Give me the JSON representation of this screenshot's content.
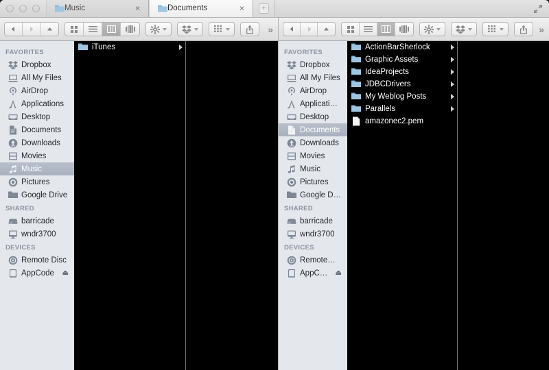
{
  "window": {
    "traffic_lights": [
      "close",
      "minimize",
      "zoom"
    ],
    "fullscreen_label": "Enter Full Screen"
  },
  "tabs": [
    {
      "label": "Music",
      "icon": "folder-icon",
      "active": false,
      "close_label": "×"
    },
    {
      "label": "Documents",
      "icon": "folder-icon",
      "active": true,
      "close_label": "×"
    }
  ],
  "new_tab_button": "+",
  "toolbar": {
    "nav": {
      "back": "◀",
      "forward": "▶",
      "up": "▲"
    },
    "view_modes": [
      {
        "name": "icon-view",
        "selected": false
      },
      {
        "name": "list-view",
        "selected": false
      },
      {
        "name": "column-view",
        "selected": true
      },
      {
        "name": "coverflow-view",
        "selected": false
      }
    ],
    "action_buttons": [
      {
        "name": "action-gear-button",
        "icon": "gear-icon"
      },
      {
        "name": "dropbox-button",
        "icon": "dropbox-icon"
      },
      {
        "name": "arrange-button",
        "icon": "grid-icon"
      },
      {
        "name": "share-button",
        "icon": "share-icon"
      }
    ],
    "overflow_label": "»"
  },
  "left_pane": {
    "sidebar": {
      "sections": [
        {
          "title": "FAVORITES",
          "items": [
            {
              "label": "Dropbox",
              "icon": "dropbox-icon",
              "selected": false
            },
            {
              "label": "All My Files",
              "icon": "all-my-files-icon",
              "selected": false
            },
            {
              "label": "AirDrop",
              "icon": "airdrop-icon",
              "selected": false
            },
            {
              "label": "Applications",
              "icon": "applications-icon",
              "selected": false
            },
            {
              "label": "Desktop",
              "icon": "desktop-icon",
              "selected": false
            },
            {
              "label": "Documents",
              "icon": "documents-icon",
              "selected": false
            },
            {
              "label": "Downloads",
              "icon": "downloads-icon",
              "selected": false
            },
            {
              "label": "Movies",
              "icon": "movies-icon",
              "selected": false
            },
            {
              "label": "Music",
              "icon": "music-icon",
              "selected": true
            },
            {
              "label": "Pictures",
              "icon": "pictures-icon",
              "selected": false
            },
            {
              "label": "Google Drive",
              "icon": "folder-icon",
              "selected": false
            }
          ]
        },
        {
          "title": "SHARED",
          "items": [
            {
              "label": "barricade",
              "icon": "server-icon",
              "selected": false
            },
            {
              "label": "wndr3700",
              "icon": "display-icon",
              "selected": false
            }
          ]
        },
        {
          "title": "DEVICES",
          "items": [
            {
              "label": "Remote Disc",
              "icon": "disc-icon",
              "selected": false
            },
            {
              "label": "AppCode",
              "icon": "drive-icon",
              "selected": false,
              "eject": "⏏"
            }
          ]
        }
      ]
    },
    "columns": [
      {
        "items": [
          {
            "label": "iTunes",
            "type": "folder",
            "has_children": true
          }
        ]
      },
      {
        "items": []
      }
    ]
  },
  "right_pane": {
    "sidebar": {
      "sections": [
        {
          "title": "FAVORITES",
          "items": [
            {
              "label": "Dropbox",
              "icon": "dropbox-icon",
              "selected": false
            },
            {
              "label": "All My Files",
              "icon": "all-my-files-icon",
              "selected": false
            },
            {
              "label": "AirDrop",
              "icon": "airdrop-icon",
              "selected": false
            },
            {
              "label": "Applicati…",
              "icon": "applications-icon",
              "selected": false
            },
            {
              "label": "Desktop",
              "icon": "desktop-icon",
              "selected": false
            },
            {
              "label": "Documents",
              "icon": "documents-icon",
              "selected": true
            },
            {
              "label": "Downloads",
              "icon": "downloads-icon",
              "selected": false
            },
            {
              "label": "Movies",
              "icon": "movies-icon",
              "selected": false
            },
            {
              "label": "Music",
              "icon": "music-icon",
              "selected": false
            },
            {
              "label": "Pictures",
              "icon": "pictures-icon",
              "selected": false
            },
            {
              "label": "Google D…",
              "icon": "folder-icon",
              "selected": false
            }
          ]
        },
        {
          "title": "SHARED",
          "items": [
            {
              "label": "barricade",
              "icon": "server-icon",
              "selected": false
            },
            {
              "label": "wndr3700",
              "icon": "display-icon",
              "selected": false
            }
          ]
        },
        {
          "title": "DEVICES",
          "items": [
            {
              "label": "Remote…",
              "icon": "disc-icon",
              "selected": false
            },
            {
              "label": "AppC…",
              "icon": "drive-icon",
              "selected": false,
              "eject": "⏏"
            }
          ]
        }
      ]
    },
    "columns": [
      {
        "items": [
          {
            "label": "ActionBarSherlock",
            "type": "folder",
            "has_children": true
          },
          {
            "label": "Graphic Assets",
            "type": "folder",
            "has_children": true
          },
          {
            "label": "IdeaProjects",
            "type": "folder",
            "has_children": true
          },
          {
            "label": "JDBCDrivers",
            "type": "folder",
            "has_children": true
          },
          {
            "label": "My Weblog Posts",
            "type": "folder",
            "has_children": true
          },
          {
            "label": "Parallels",
            "type": "folder",
            "has_children": true
          },
          {
            "label": "amazonec2.pem",
            "type": "file",
            "has_children": false
          }
        ]
      },
      {
        "items": []
      }
    ]
  },
  "colors": {
    "content_background": "#000000",
    "sidebar_background": "#e4e7ec",
    "selection_sidebar": "#b0b8c4",
    "folder_icon": "#9fc6e0"
  }
}
